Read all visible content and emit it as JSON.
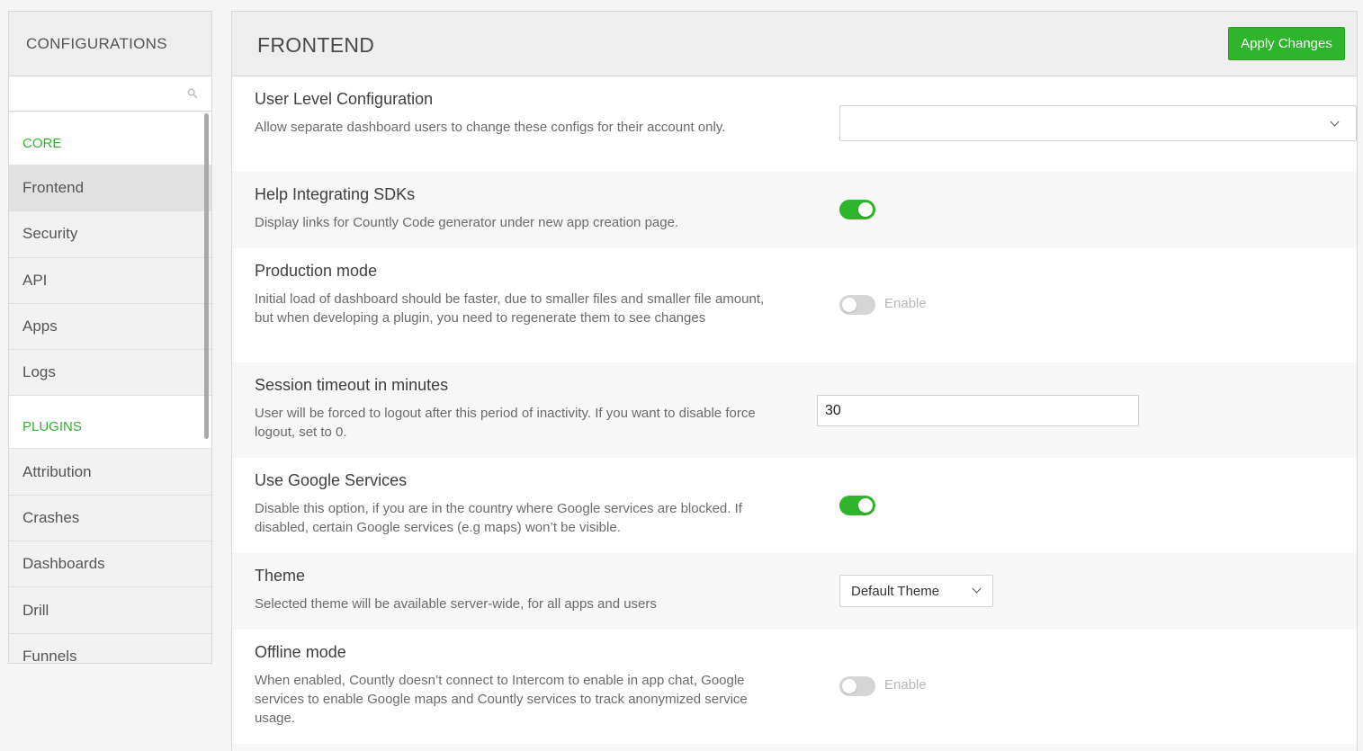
{
  "sidebar": {
    "title": "CONFIGURATIONS",
    "search_placeholder": "",
    "groups": [
      {
        "label": "CORE",
        "items": [
          "Frontend",
          "Security",
          "API",
          "Apps",
          "Logs"
        ]
      },
      {
        "label": "PLUGINS",
        "items": [
          "Attribution",
          "Crashes",
          "Dashboards",
          "Drill",
          "Funnels"
        ]
      }
    ],
    "active_item": "Frontend"
  },
  "main": {
    "title": "FRONTEND",
    "apply_label": "Apply Changes",
    "settings": {
      "user_level": {
        "title": "User Level Configuration",
        "desc": "Allow separate dashboard users to change these configs for their account only.",
        "value": ""
      },
      "help_sdks": {
        "title": "Help Integrating SDKs",
        "desc": "Display links for Countly Code generator under new app creation page.",
        "enabled": true
      },
      "production_mode": {
        "title": "Production mode",
        "desc": "Initial load of dashboard should be faster, due to smaller files and smaller file amount, but when developing a plugin, you need to regenerate them to see changes",
        "enabled": false,
        "toggle_label": "Enable"
      },
      "session_timeout": {
        "title": "Session timeout in minutes",
        "desc": "User will be forced to logout after this period of inactivity. If you want to disable force logout, set to 0.",
        "value": "30"
      },
      "google_services": {
        "title": "Use Google Services",
        "desc": "Disable this option, if you are in the country where Google services are blocked. If disabled, certain Google services (e.g maps) won’t be visible.",
        "enabled": true
      },
      "theme": {
        "title": "Theme",
        "desc": "Selected theme will be available server-wide, for all apps and users",
        "value": "Default Theme"
      },
      "offline_mode": {
        "title": "Offline mode",
        "desc": "When enabled, Countly doesn’t connect to Intercom to enable in app chat, Google services to enable Google maps and Countly services to track anonymized service usage.",
        "enabled": false,
        "toggle_label": "Enable"
      }
    }
  },
  "colors": {
    "accent": "#2eb52b",
    "toggle_off": "#d6d6d6"
  },
  "icons": {
    "search": "search-icon",
    "dropdown": "chevron-down-icon"
  }
}
